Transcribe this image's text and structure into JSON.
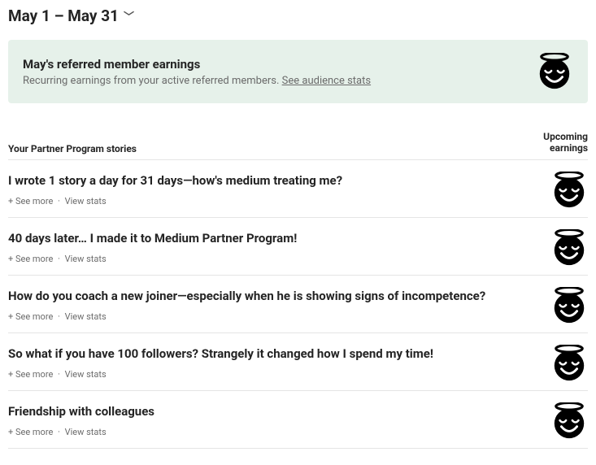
{
  "dateRange": "May 1 – May 31",
  "referral": {
    "title": "May's referred member earnings",
    "subtext": "Recurring earnings from your active referred members. ",
    "link": "See audience stats"
  },
  "tableHead": {
    "left": "Your Partner Program stories",
    "rightLine1": "Upcoming",
    "rightLine2": "earnings"
  },
  "actions": {
    "seeMore": "+ See more",
    "viewStats": "View stats",
    "dot": "·"
  },
  "stories": [
    {
      "title": "I wrote 1 story a day for 31 days—how's medium treating me?"
    },
    {
      "title": "40 days later… I made it to Medium Partner Program!"
    },
    {
      "title": "How do you coach a new joiner—especially when he is showing signs of incompetence?"
    },
    {
      "title": "So what if you have 100 followers? Strangely it changed how I spend my time!"
    },
    {
      "title": "Friendship with colleagues"
    }
  ]
}
